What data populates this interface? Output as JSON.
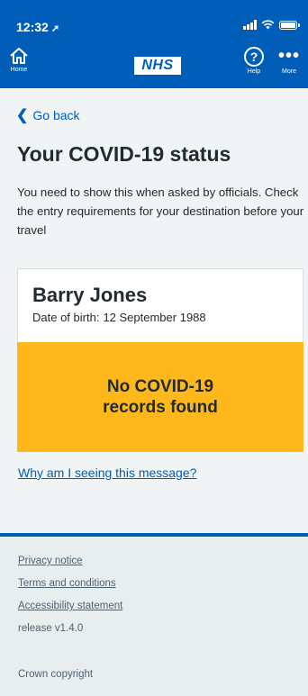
{
  "status_bar": {
    "time": "12:32",
    "location_arrow": "➚"
  },
  "nav": {
    "home_label": "Home",
    "logo_text": "NHS",
    "help_label": "Help",
    "help_glyph": "?",
    "more_label": "More",
    "more_glyph": "•••"
  },
  "back_link": {
    "chevron": "❮",
    "label": "Go back"
  },
  "page_title": "Your COVID-19 status",
  "intro_text": "You need to show this when asked by officials. Check the entry requirements for your destination before your travel",
  "card": {
    "name": "Barry Jones",
    "dob_label": "Date of birth:",
    "dob_value": "12 September 1988",
    "status_line1": "No COVID-19",
    "status_line2": "records found",
    "status_color": "#ffb81c"
  },
  "why_link": "Why am I seeing this message?",
  "footer": {
    "privacy": "Privacy notice",
    "terms": "Terms and conditions",
    "accessibility": "Accessibility statement",
    "release": "release v1.4.0",
    "copyright": "Crown copyright"
  },
  "colors": {
    "nhs_blue": "#005eb8",
    "warning_yellow": "#ffb81c",
    "background": "#f0f4f5"
  }
}
